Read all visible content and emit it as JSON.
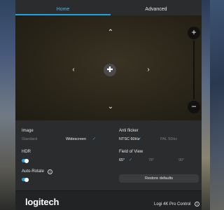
{
  "tabs": [
    {
      "label": "Home",
      "active": true
    },
    {
      "label": "Advanced",
      "active": false
    }
  ],
  "preview": {
    "pan_up_icon": "chevron-up",
    "pan_down_icon": "chevron-down",
    "pan_left_icon": "chevron-left",
    "pan_right_icon": "chevron-right",
    "move_icon": "move-cross",
    "zoom_in_label": "+",
    "zoom_out_label": "−"
  },
  "settings": {
    "image": {
      "label": "Image",
      "options": [
        {
          "label": "Standard",
          "selected": false
        },
        {
          "label": "Widescreen",
          "selected": true
        }
      ]
    },
    "anti_flicker": {
      "label": "Anti flicker",
      "options": [
        {
          "label": "NTSC 60Hz",
          "selected": true
        },
        {
          "label": "PAL 50Hz",
          "selected": false
        }
      ]
    },
    "hdr": {
      "label": "HDR",
      "enabled": true
    },
    "auto_rotate": {
      "label": "Auto-Rotate",
      "enabled": true
    },
    "field_of_view": {
      "label": "Field of View",
      "options": [
        {
          "label": "65°",
          "selected": true
        },
        {
          "label": "78°",
          "selected": false
        },
        {
          "label": "90°",
          "selected": false
        }
      ]
    },
    "restore_label": "Restore defaults"
  },
  "footer": {
    "logo": "logitech",
    "product": "Logi 4K Pro Control"
  },
  "colors": {
    "accent": "#1fa2e0",
    "window_bg": "#2b2c2e",
    "footer_bg": "#222325"
  }
}
